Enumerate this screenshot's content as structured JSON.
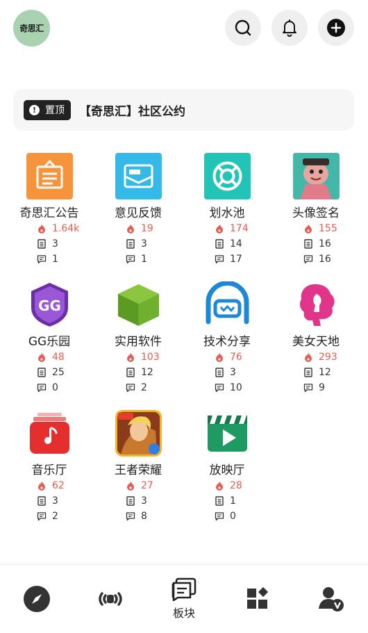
{
  "header": {
    "logo_text": "奇思汇",
    "icons": [
      "search-icon",
      "bell-icon",
      "plus-icon"
    ]
  },
  "pinned": {
    "badge_label": "置顶",
    "badge_icon": "info-icon",
    "title": "【奇思汇】社区公约"
  },
  "boards": [
    {
      "name": "奇思汇公告",
      "hot": "1.64k",
      "posts": "3",
      "comments": "1",
      "icon": "notice-board-icon"
    },
    {
      "name": "意见反馈",
      "hot": "19",
      "posts": "3",
      "comments": "1",
      "icon": "mail-icon"
    },
    {
      "name": "划水池",
      "hot": "174",
      "posts": "14",
      "comments": "17",
      "icon": "lifebuoy-icon"
    },
    {
      "name": "头像签名",
      "hot": "155",
      "posts": "16",
      "comments": "16",
      "icon": "cartoon-avatar-icon"
    },
    {
      "name": "GG乐园",
      "hot": "48",
      "posts": "25",
      "comments": "0",
      "icon": "gg-shield-icon"
    },
    {
      "name": "实用软件",
      "hot": "103",
      "posts": "12",
      "comments": "2",
      "icon": "green-cube-icon"
    },
    {
      "name": "技术分享",
      "hot": "76",
      "posts": "3",
      "comments": "10",
      "icon": "robot-face-icon"
    },
    {
      "name": "美女天地",
      "hot": "293",
      "posts": "12",
      "comments": "9",
      "icon": "woman-silhouette-icon"
    },
    {
      "name": "音乐厅",
      "hot": "62",
      "posts": "3",
      "comments": "2",
      "icon": "music-note-icon"
    },
    {
      "name": "王者荣耀",
      "hot": "27",
      "posts": "3",
      "comments": "8",
      "icon": "game-hero-icon"
    },
    {
      "name": "放映厅",
      "hot": "28",
      "posts": "1",
      "comments": "0",
      "icon": "clapperboard-icon"
    }
  ],
  "nav": {
    "items": [
      {
        "icon": "compass-icon",
        "label": ""
      },
      {
        "icon": "broadcast-icon",
        "label": ""
      },
      {
        "icon": "board-chat-icon",
        "label": "板块"
      },
      {
        "icon": "apps-grid-icon",
        "label": ""
      },
      {
        "icon": "user-vip-icon",
        "label": ""
      }
    ]
  },
  "colors": {
    "hot": "#e55b4f",
    "logo_bg": "#a9d3b0",
    "pin_badge": "#222222"
  }
}
